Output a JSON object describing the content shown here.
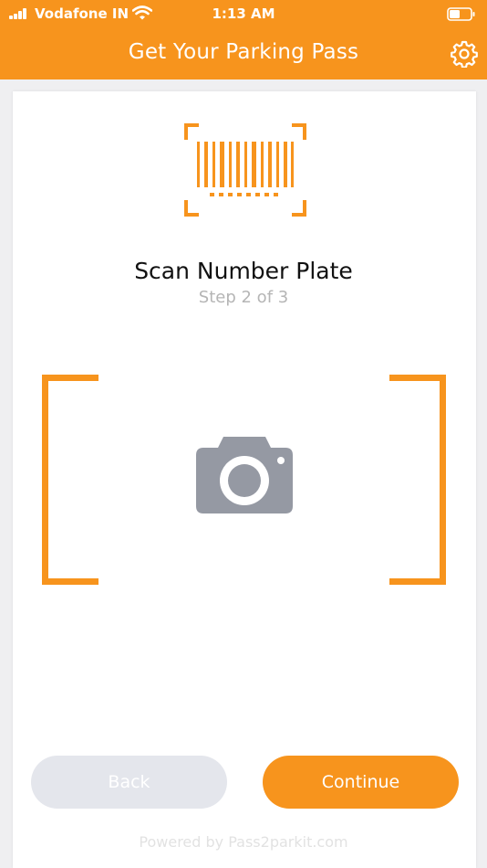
{
  "status_bar": {
    "carrier": "Vodafone IN",
    "time": "1:13 AM"
  },
  "header": {
    "title": "Get Your Parking Pass",
    "settings_icon": "gear-icon"
  },
  "scan": {
    "icon": "barcode-scan-icon",
    "title": "Scan Number Plate",
    "step": "Step 2 of 3",
    "camera_icon": "camera-icon"
  },
  "buttons": {
    "back_label": "Back",
    "continue_label": "Continue"
  },
  "footer": {
    "powered_by": "Powered by Pass2parkit.com"
  },
  "colors": {
    "accent": "#f7941d",
    "back_button": "#e4e6ec",
    "camera": "#9599a3",
    "step_text": "#b5b5b5"
  }
}
